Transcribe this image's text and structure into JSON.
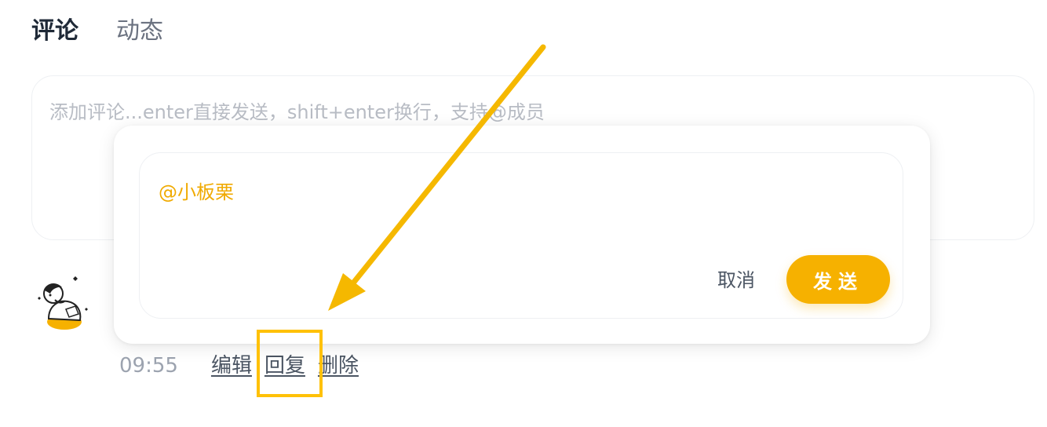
{
  "tabs": [
    {
      "label": "评论",
      "active": true
    },
    {
      "label": "动态",
      "active": false
    }
  ],
  "comment_input": {
    "placeholder": "添加评论...enter直接发送，shift+enter换行，支持@成员"
  },
  "reply_popup": {
    "mention_text": "@小板栗",
    "cancel_label": "取消",
    "send_label": "发送"
  },
  "comment_meta": {
    "time": "09:55",
    "edit_label": "编辑",
    "reply_label": "回复",
    "delete_label": "删除"
  },
  "colors": {
    "accent": "#f6b100",
    "mention": "#f0aa00",
    "annotation": "#ffc107",
    "text_primary": "#1f2937",
    "text_muted": "#9ca3af"
  }
}
